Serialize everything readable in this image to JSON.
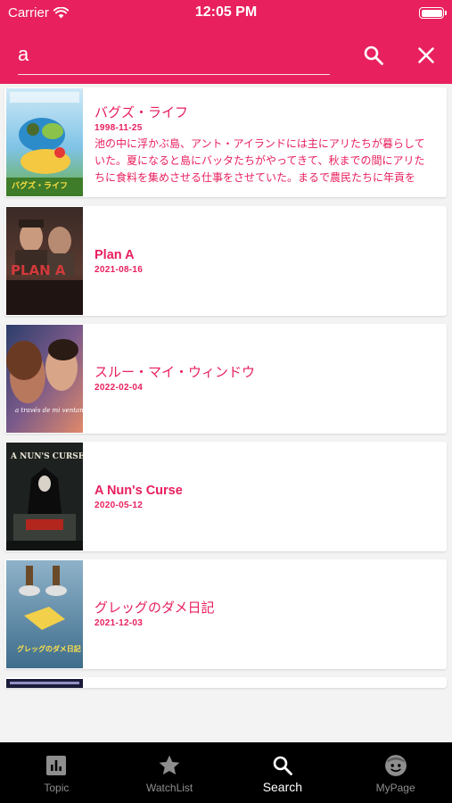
{
  "status_bar": {
    "carrier": "Carrier",
    "time": "12:05 PM"
  },
  "search": {
    "value": "a",
    "placeholder": ""
  },
  "icons": {
    "search": "search-icon",
    "close": "close-icon",
    "wifi": "wifi-icon",
    "battery": "battery-icon"
  },
  "colors": {
    "accent": "#e8205e",
    "tabbar_bg": "#000000",
    "tab_inactive": "#8e8e8e",
    "tab_active": "#ffffff"
  },
  "results": [
    {
      "title": "バグズ・ライフ",
      "date": "1998-11-25",
      "description": "池の中に浮かぶ島、アント・アイランドには主にアリたちが暮らしていた。夏になると島にバッタたちがやってきて、秋までの間にアリたちに食料を集めさせる仕事をさせていた。まるで農民たちに年貢を",
      "poster_text": "バグズ・ライフ"
    },
    {
      "title": "Plan A",
      "date": "2021-08-16",
      "description": "",
      "poster_text": "PLAN A"
    },
    {
      "title": "スルー・マイ・ウィンドウ",
      "date": "2022-02-04",
      "description": "",
      "poster_text": "a través de mi ventana"
    },
    {
      "title": "A Nun's Curse",
      "date": "2020-05-12",
      "description": "",
      "poster_text": "A NUN'S CURSE"
    },
    {
      "title": "グレッグのダメ日記",
      "date": "2021-12-03",
      "description": "",
      "poster_text": "グレッグのダメ日記"
    }
  ],
  "tabs": [
    {
      "label": "Topic",
      "icon": "chart-icon",
      "active": false
    },
    {
      "label": "WatchList",
      "icon": "star-icon",
      "active": false
    },
    {
      "label": "Search",
      "icon": "search-icon",
      "active": true
    },
    {
      "label": "MyPage",
      "icon": "face-icon",
      "active": false
    }
  ]
}
